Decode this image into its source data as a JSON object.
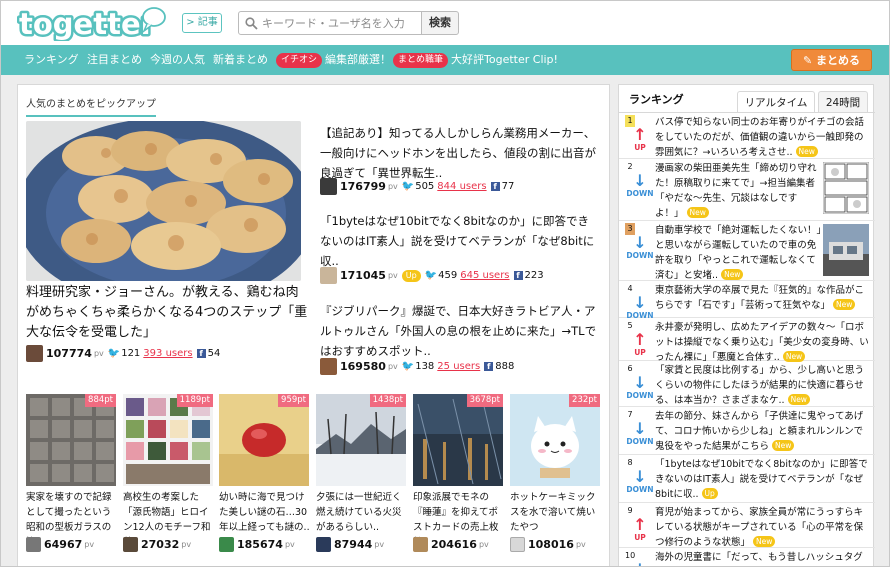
{
  "header": {
    "logo_text": "togetter",
    "kiji_label": "記事",
    "kiji_arrow": ">",
    "search_placeholder": "キーワード・ユーザ名を入力",
    "search_button": "検索"
  },
  "nav": {
    "items": [
      "ランキング",
      "注目まとめ",
      "今週の人気",
      "新着まとめ"
    ],
    "promo1_badge": "イチオシ",
    "promo1_label": "編集部厳選！",
    "promo2_badge": "まとめ職筆",
    "promo2_label": "大好評Togetter Clip!",
    "matome_button": "まとめる"
  },
  "pickup": {
    "heading": "人気のまとめをピックアップ",
    "featured": {
      "title": "料理研究家・ジョーさん。が教える、鶏むね肉がめちゃくちゃ柔らかくなる4つのステップ「重大な伝令を受電した」",
      "pv": "107774",
      "pv_label": "pv",
      "tw": "121",
      "users": "393 users",
      "fb": "54"
    },
    "side": [
      {
        "title": "【追記あり】知ってる人しかしらん業務用メーカー、一般向けにヘッドホンを出したら、値段の割に出音が良過ぎて「異世界転生..",
        "pv": "176799",
        "tw": "505",
        "users": "844 users",
        "fb": "77",
        "up": ""
      },
      {
        "title": "「1byteはなぜ10bitでなく8bitなのか」に即答できないのはIT素人」説を受けてベテランが「なぜ8bitに収..",
        "pv": "171045",
        "tw": "459",
        "users": "645 users",
        "fb": "223",
        "up": "Up"
      },
      {
        "title": "『ジブリパーク』爆誕で、日本大好きラトビア人・アルトゥルさん「外国人の息の根を止めに来た」→TLではおすすめスポット..",
        "pv": "169580",
        "tw": "138",
        "users": "25 users",
        "fb": "888",
        "up": ""
      }
    ],
    "thumbs": [
      {
        "pt": "884pt",
        "title": "実家を壊すので記録として撮ったという昭和の型板ガラスの懐..",
        "pv": "64967"
      },
      {
        "pt": "1189pt",
        "title": "高校生の考案した「源氏物語」ヒロイン12人のモチーフ和菓..",
        "pv": "27032"
      },
      {
        "pt": "959pt",
        "title": "幼い時に海で見つけた美しい謎の石…30年以上経っても謎の..",
        "pv": "185674"
      },
      {
        "pt": "1438pt",
        "title": "夕張には一世紀近く燃え続けている火災があるらしい..",
        "pv": "87944"
      },
      {
        "pt": "3678pt",
        "title": "印象派展でモネの『睡蓮』を抑えてポストカードの売上枚数..",
        "pv": "204616"
      },
      {
        "pt": "232pt",
        "title": "ホットケーキミックスを水で溶いて焼いたやつ",
        "pv": "108016"
      }
    ]
  },
  "ranking": {
    "heading": "ランキング",
    "tab_realtime": "リアルタイム",
    "tab_24h": "24時間",
    "new_label": "New",
    "items": [
      {
        "rank": "1",
        "dir": "up",
        "dir_label": "UP",
        "text": "バス停で知らない同士のお年寄りがイチゴの会話をしていたのだが、価値観の違いから一触即発の雰囲気に？→いろいろ考えさせ..",
        "new": true,
        "thumb": false
      },
      {
        "rank": "2",
        "dir": "down",
        "dir_label": "DOWN",
        "text": "漫画家の柴田亜美先生「締め切り守れた！原稿取りに来てで」→担当編集者「やだな～先生、冗談はなしですよ！」",
        "new": true,
        "thumb": true
      },
      {
        "rank": "3",
        "dir": "down",
        "dir_label": "DOWN",
        "text": "自動車学校で「絶対運転したくない！」と思いながら運転していたので車の免許を取り「やっとこれで運転しなくて済む」と安堵..",
        "new": true,
        "thumb": true
      },
      {
        "rank": "4",
        "dir": "down",
        "dir_label": "DOWN",
        "text": "東京藝術大学の卒展で見た『狂気的』な作品がこちらです「石です」「芸術って狂気やな」",
        "new": true,
        "thumb": false
      },
      {
        "rank": "5",
        "dir": "up",
        "dir_label": "UP",
        "text": "永井豪が発明し、広めたアイデアの数々～「ロボットは操縦でなく乗り込む」「美少女の変身時、いったん裸に」「悪魔と合体す..",
        "new": true,
        "thumb": false
      },
      {
        "rank": "6",
        "dir": "down",
        "dir_label": "DOWN",
        "text": "「家賃と民度は比例する」から、少し高いと思うくらいの物件にしたほうが結果的に快適に暮らせる、は本当か？さまざまなケ..",
        "new": true,
        "thumb": false
      },
      {
        "rank": "7",
        "dir": "down",
        "dir_label": "DOWN",
        "text": "去年の節分、妹さんから「子供達に鬼やってあげて、コロナ怖いから少しね」と頼まれルンルンで鬼役をやった結果がこちら",
        "new": true,
        "thumb": false
      },
      {
        "rank": "8",
        "dir": "down",
        "dir_label": "DOWN",
        "text": "「1byteはなぜ10bitでなく8bitなのか」に即答できないのはIT素人」説を受けてベテランが「なぜ8bitに収..",
        "new": false,
        "up_badge": "Up",
        "thumb": false
      },
      {
        "rank": "9",
        "dir": "up",
        "dir_label": "UP",
        "text": "育児が始まってから、家族全員が常にうっすらキレている状態がキープされている「心の平常を保つ修行のような状態」",
        "new": true,
        "thumb": false
      },
      {
        "rank": "10",
        "dir": "down",
        "dir_label": "DOWN",
        "text": "海外の児童書に「だって、もう昔しハッシュタグ",
        "new": false,
        "thumb": false
      }
    ]
  },
  "colors": {
    "teal": "#58c1be",
    "orange": "#f08a3a",
    "red": "#e8334a",
    "blue": "#3a8fd6"
  }
}
